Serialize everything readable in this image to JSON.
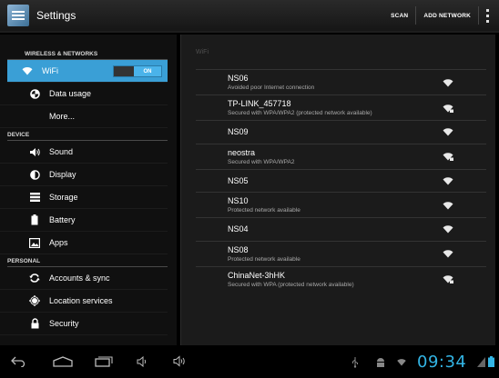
{
  "actionbar": {
    "title": "Settings",
    "actions": [
      "SCAN",
      "ADD NETWORK"
    ],
    "app_icon": "settings-icon",
    "overflow_icon": "overflow-menu-icon"
  },
  "sidebar": {
    "sections": [
      {
        "header": "WIRELESS & NETWORKS",
        "items": [
          {
            "label": "WiFi",
            "icon": "wifi-icon",
            "selected": true,
            "toggle": "ON"
          },
          {
            "label": "Data usage",
            "icon": "data-usage-icon"
          },
          {
            "label": "More...",
            "icon": ""
          }
        ]
      },
      {
        "header": "DEVICE",
        "items": [
          {
            "label": "Sound",
            "icon": "sound-icon"
          },
          {
            "label": "Display",
            "icon": "display-icon"
          },
          {
            "label": "Storage",
            "icon": "storage-icon"
          },
          {
            "label": "Battery",
            "icon": "battery-icon"
          },
          {
            "label": "Apps",
            "icon": "apps-icon"
          }
        ]
      },
      {
        "header": "PERSONAL",
        "items": [
          {
            "label": "Accounts & sync",
            "icon": "sync-icon"
          },
          {
            "label": "Location services",
            "icon": "location-icon"
          },
          {
            "label": "Security",
            "icon": "lock-icon"
          }
        ]
      }
    ]
  },
  "wifi_pane": {
    "title": "WiFi",
    "networks": [
      {
        "ssid": "NS06",
        "status": "Avoided poor Internet connection",
        "locked": false
      },
      {
        "ssid": "TP-LINK_457718",
        "status": "Secured with WPA/WPA2 (protected network available)",
        "locked": true
      },
      {
        "ssid": "NS09",
        "status": "",
        "locked": false
      },
      {
        "ssid": "neostra",
        "status": "Secured with WPA/WPA2",
        "locked": true
      },
      {
        "ssid": "NS05",
        "status": "",
        "locked": false
      },
      {
        "ssid": "NS10",
        "status": "Protected network available",
        "locked": false
      },
      {
        "ssid": "NS04",
        "status": "",
        "locked": false
      },
      {
        "ssid": "NS08",
        "status": "Protected network available",
        "locked": false
      },
      {
        "ssid": "ChinaNet-3hHK",
        "status": "Secured with WPA (protected network available)",
        "locked": true
      }
    ]
  },
  "navbar": {
    "time": "09:34",
    "buttons": [
      "back-icon",
      "home-icon",
      "recent-apps-icon",
      "volume-down-icon",
      "volume-up-icon"
    ],
    "status_icons": [
      "usb-icon",
      "android-debug-icon",
      "wifi-status-icon",
      "signal-icon",
      "battery-status-icon"
    ]
  },
  "colors": {
    "accent": "#33b5e5",
    "selected_bg": "#3a9fd6"
  }
}
